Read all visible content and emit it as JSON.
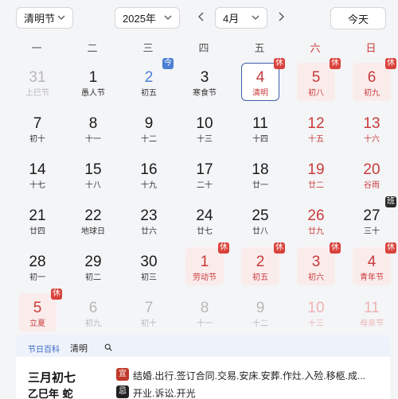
{
  "toolbar": {
    "festival_select": "清明节",
    "year_select": "2025年",
    "month_select": "4月",
    "today_label": "今天"
  },
  "weekdays": [
    "一",
    "二",
    "三",
    "四",
    "五",
    "六",
    "日"
  ],
  "badge_labels": {
    "rest": "休",
    "work": "班",
    "today": "今"
  },
  "weeks": [
    [
      {
        "day": "31",
        "sub": "上巳节",
        "state": "dim"
      },
      {
        "day": "1",
        "sub": "愚人节"
      },
      {
        "day": "2",
        "sub": "初五",
        "badge": "today",
        "accent": "blue"
      },
      {
        "day": "3",
        "sub": "寒食节"
      },
      {
        "day": "4",
        "sub": "清明",
        "red": true,
        "badge": "rest",
        "selected": true
      },
      {
        "day": "5",
        "sub": "初八",
        "red": true,
        "badge": "rest",
        "holiday": true
      },
      {
        "day": "6",
        "sub": "初九",
        "red": true,
        "badge": "rest",
        "holiday": true
      }
    ],
    [
      {
        "day": "7",
        "sub": "初十"
      },
      {
        "day": "8",
        "sub": "十一"
      },
      {
        "day": "9",
        "sub": "十二"
      },
      {
        "day": "10",
        "sub": "十三"
      },
      {
        "day": "11",
        "sub": "十四"
      },
      {
        "day": "12",
        "sub": "十五",
        "red": true
      },
      {
        "day": "13",
        "sub": "十六",
        "red": true
      }
    ],
    [
      {
        "day": "14",
        "sub": "十七"
      },
      {
        "day": "15",
        "sub": "十八"
      },
      {
        "day": "16",
        "sub": "十九"
      },
      {
        "day": "17",
        "sub": "二十"
      },
      {
        "day": "18",
        "sub": "廿一"
      },
      {
        "day": "19",
        "sub": "廿二",
        "red": true
      },
      {
        "day": "20",
        "sub": "谷雨",
        "red": true
      }
    ],
    [
      {
        "day": "21",
        "sub": "廿四"
      },
      {
        "day": "22",
        "sub": "地球日"
      },
      {
        "day": "23",
        "sub": "廿六"
      },
      {
        "day": "24",
        "sub": "廿七"
      },
      {
        "day": "25",
        "sub": "廿八"
      },
      {
        "day": "26",
        "sub": "廿九",
        "red": true
      },
      {
        "day": "27",
        "sub": "三十",
        "badge": "work"
      }
    ],
    [
      {
        "day": "28",
        "sub": "初一"
      },
      {
        "day": "29",
        "sub": "初二"
      },
      {
        "day": "30",
        "sub": "初三"
      },
      {
        "day": "1",
        "sub": "劳动节",
        "red": true,
        "badge": "rest",
        "holiday": true
      },
      {
        "day": "2",
        "sub": "初五",
        "red": true,
        "badge": "rest",
        "holiday": true
      },
      {
        "day": "3",
        "sub": "初六",
        "red": true,
        "badge": "rest",
        "holiday": true
      },
      {
        "day": "4",
        "sub": "青年节",
        "red": true,
        "badge": "rest",
        "holiday": true
      }
    ],
    [
      {
        "day": "5",
        "sub": "立夏",
        "red": true,
        "badge": "rest",
        "holiday": true
      },
      {
        "day": "6",
        "sub": "初九",
        "state": "dim"
      },
      {
        "day": "7",
        "sub": "初十",
        "state": "dim"
      },
      {
        "day": "8",
        "sub": "十一",
        "state": "dim"
      },
      {
        "day": "9",
        "sub": "十二",
        "state": "dim"
      },
      {
        "day": "10",
        "sub": "十三",
        "state": "dim",
        "red": true
      },
      {
        "day": "11",
        "sub": "母亲节",
        "state": "dim",
        "red": true
      }
    ]
  ],
  "panel": {
    "tab_label": "节日百科",
    "tab_name": "清明",
    "lunar_date": "三月初七",
    "ganzhi": "乙巳年 蛇",
    "yi_label": "宜",
    "yi_text": "结婚.出行.签订合同.交易.安床.安葬.作灶.入殓.移柩.成...",
    "ji_label": "忌",
    "ji_text": "开业.诉讼.开光"
  },
  "colors": {
    "accent_red": "#c83a3a",
    "today_blue": "#4a7fd4",
    "holiday_bg": "#fbecec"
  }
}
